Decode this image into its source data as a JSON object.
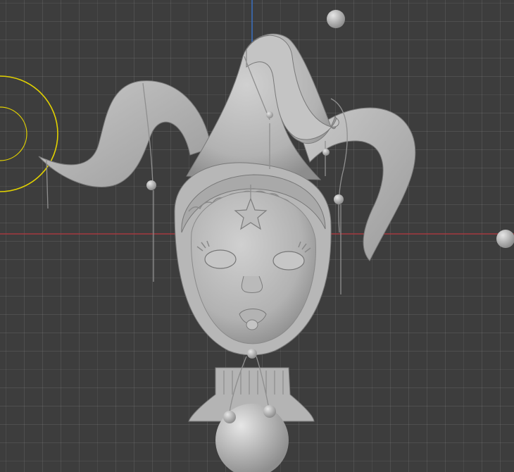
{
  "viewport": {
    "background_color": "#3d3d3d",
    "grid_color": "#4a4a4a",
    "axis_x_color": "#a43a3f",
    "axis_z_color": "#3a6fc0",
    "light_gizmo_color": "#e2d200",
    "model_color": "#bdbdbd"
  },
  "objects": {
    "model": "jester-head",
    "light": "sun-light",
    "empties": [
      "sphere-empty-top",
      "sphere-empty-right"
    ]
  }
}
